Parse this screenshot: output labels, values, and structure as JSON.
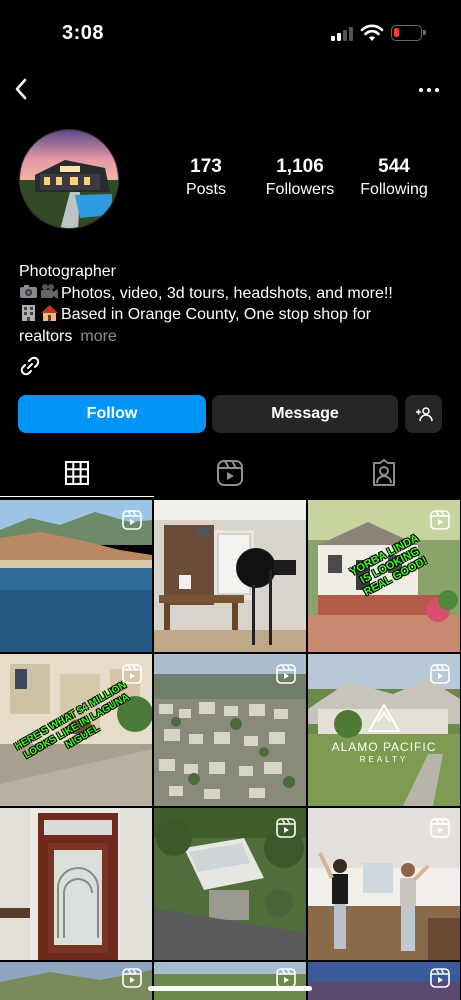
{
  "status_bar": {
    "time": "3:08",
    "icons": [
      "signal-icon",
      "wifi-icon",
      "battery-icon"
    ],
    "battery_color": "#ff3b30"
  },
  "nav": {
    "back_icon": "chevron-left-icon",
    "more_icon": "more-horizontal-icon"
  },
  "profile": {
    "stats": [
      {
        "value": "173",
        "label": "Posts"
      },
      {
        "value": "1,106",
        "label": "Followers"
      },
      {
        "value": "544",
        "label": "Following"
      }
    ],
    "bio": {
      "category": "Photographer",
      "line1_emojis": [
        "camera-emoji",
        "movie-camera-emoji"
      ],
      "line1": "Photos, video, 3d tours, headshots, and more!!",
      "line2_emojis": [
        "office-building-emoji",
        "house-emoji"
      ],
      "line2": "Based in Orange County, One stop shop for",
      "line3": "realtors",
      "more": "more"
    },
    "link_icon": "link-icon"
  },
  "actions": {
    "follow": "Follow",
    "message": "Message",
    "add_user_icon": "add-user-icon",
    "follow_color": "#0095f6",
    "secondary_color": "#262626"
  },
  "tabs": [
    {
      "icon": "grid-icon",
      "selected": true
    },
    {
      "icon": "reels-icon",
      "selected": false
    },
    {
      "icon": "tagged-icon",
      "selected": false
    }
  ],
  "grid": {
    "overlays": {
      "post3": "YORBA LINDA IS LOOKING REAL GOOD!",
      "post4": "HERE'S WHAT $4 MILLION LOOKS LIKE IN LAGUNA NIGUEL",
      "post6_logo": "ALAMO PACIFIC",
      "post6_sub": "REALTY"
    },
    "reel_icon": "reels-icon",
    "accent_text_color": "#39ff14"
  }
}
